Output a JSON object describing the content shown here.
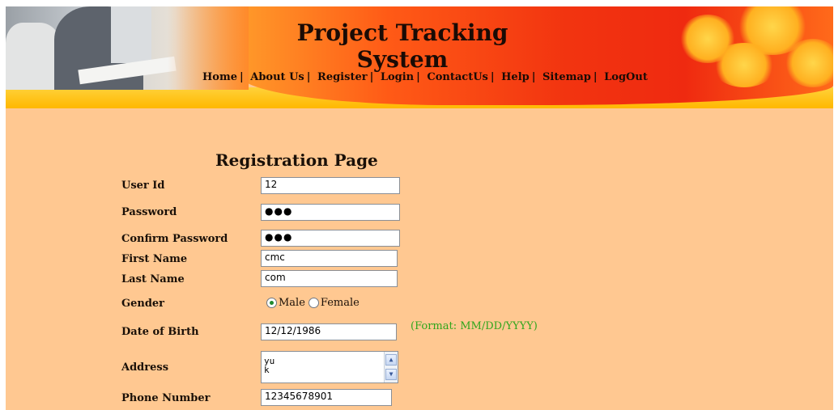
{
  "header": {
    "title": "Project Tracking System",
    "nav": [
      {
        "label": "Home"
      },
      {
        "label": "About Us"
      },
      {
        "label": "Register"
      },
      {
        "label": "Login"
      },
      {
        "label": "ContactUs"
      },
      {
        "label": "Help"
      },
      {
        "label": "Sitemap"
      },
      {
        "label": "LogOut"
      }
    ],
    "separator": "|"
  },
  "form": {
    "heading": "Registration Page",
    "fields": {
      "user_id": {
        "label": "User Id",
        "value": "12"
      },
      "password": {
        "label": "Password",
        "value": "●●●"
      },
      "confirm_password": {
        "label": "Confirm Password",
        "value": "●●●"
      },
      "first_name": {
        "label": "First Name",
        "value": "cmc"
      },
      "last_name": {
        "label": "Last Name",
        "value": "com"
      },
      "gender": {
        "label": "Gender",
        "options": [
          "Male",
          "Female"
        ],
        "selected": "Male"
      },
      "dob": {
        "label": "Date of Birth",
        "value": "12/12/1986",
        "hint": "(Format: MM/DD/YYYY)"
      },
      "address": {
        "label": "Address",
        "lines": [
          "yu",
          "k"
        ]
      },
      "phone": {
        "label": "Phone Number",
        "value": "12345678901"
      }
    }
  },
  "colors": {
    "page_background": "#ffc891",
    "hint_green": "#2fa61c",
    "radio_selected": "#1f8a2e"
  }
}
